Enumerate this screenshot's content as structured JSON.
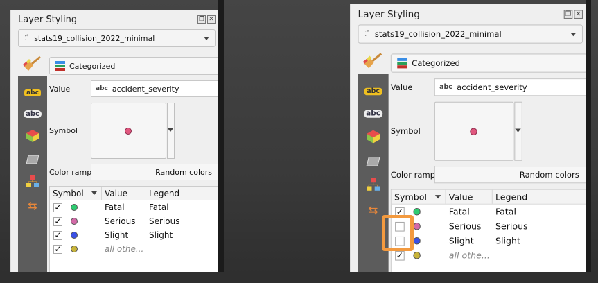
{
  "panels": [
    {
      "title": "Layer Styling",
      "layer": "stats19_collision_2022_minimal",
      "renderer": "Categorized",
      "value_label": "Value",
      "value_field": "accident_severity",
      "value_type": "abc",
      "symbol_label": "Symbol",
      "color_ramp_label": "Color ramp",
      "color_ramp": "Random colors",
      "columns": [
        "Symbol",
        "Value",
        "Legend"
      ],
      "categories": [
        {
          "checked": true,
          "color": "#2ecc71",
          "value": "Fatal",
          "legend": "Fatal"
        },
        {
          "checked": true,
          "color": "#d36aa8",
          "value": "Serious",
          "legend": "Serious"
        },
        {
          "checked": true,
          "color": "#3a50e6",
          "value": "Slight",
          "legend": "Slight"
        },
        {
          "checked": true,
          "color": "#c8b43a",
          "value": "all othe...",
          "legend": ""
        }
      ]
    },
    {
      "title": "Layer Styling",
      "layer": "stats19_collision_2022_minimal",
      "renderer": "Categorized",
      "value_label": "Value",
      "value_field": "accident_severity",
      "value_type": "abc",
      "symbol_label": "Symbol",
      "color_ramp_label": "Color ramp",
      "color_ramp": "Random colors",
      "columns": [
        "Symbol",
        "Value",
        "Legend"
      ],
      "categories": [
        {
          "checked": true,
          "color": "#2ecc71",
          "value": "Fatal",
          "legend": "Fatal"
        },
        {
          "checked": false,
          "color": "#d36aa8",
          "value": "Serious",
          "legend": "Serious"
        },
        {
          "checked": false,
          "color": "#3a50e6",
          "value": "Slight",
          "legend": "Slight"
        },
        {
          "checked": true,
          "color": "#c8b43a",
          "value": "all othe...",
          "legend": ""
        }
      ]
    }
  ],
  "highlight_color": "#f39a3f"
}
